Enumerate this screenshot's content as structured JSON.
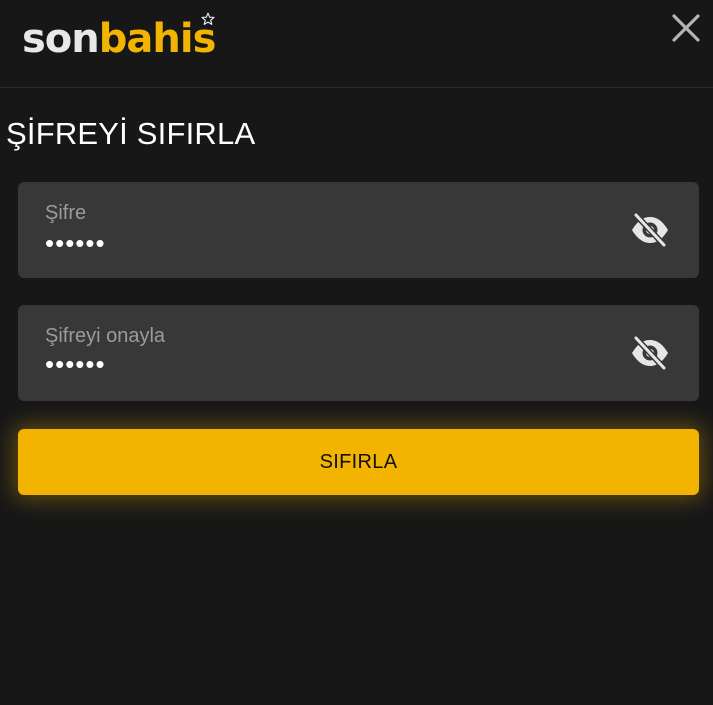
{
  "header": {
    "logo_part1": "son",
    "logo_part2": "bahis",
    "close_icon": "close-icon"
  },
  "main": {
    "title": "ŞİFREYİ SIFIRLA",
    "fields": [
      {
        "label": "Şifre",
        "value": "••••••",
        "toggle_icon": "eye-off-icon"
      },
      {
        "label": "Şifreyi onayla",
        "value": "••••••",
        "toggle_icon": "eye-off-icon"
      }
    ],
    "submit_label": "SIFIRLA"
  },
  "colors": {
    "background": "#171717",
    "brand_yellow": "#f2b400",
    "field_bg": "#383838",
    "label_gray": "#9b9b9b"
  }
}
